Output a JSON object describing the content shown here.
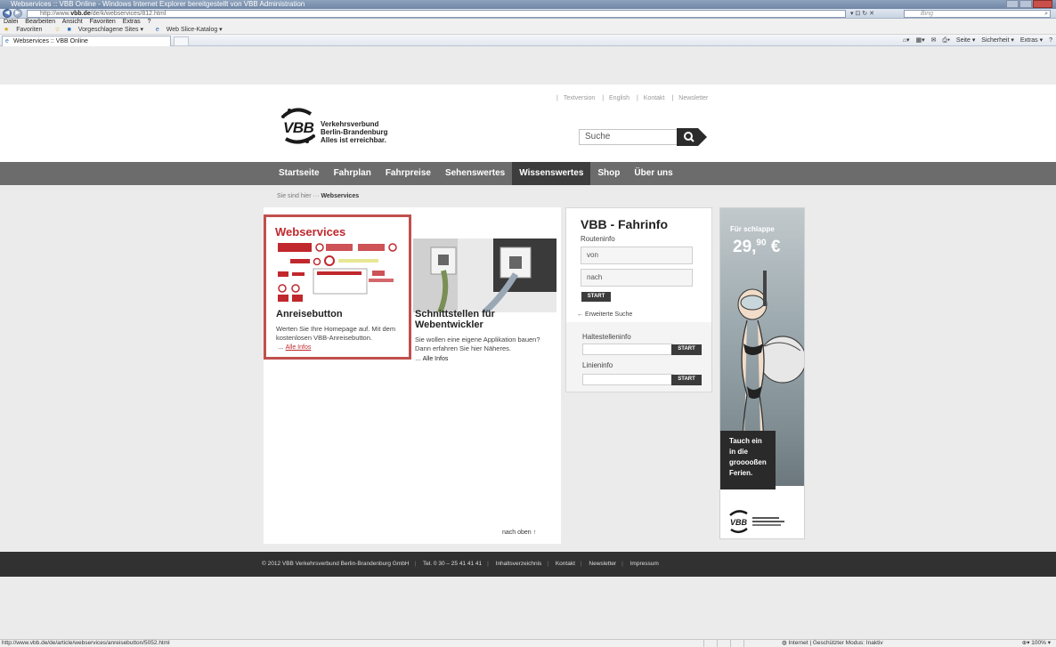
{
  "browser": {
    "window_title": "Webservices :: VBB Online - Windows Internet Explorer bereitgestellt von VBB Administration",
    "url_prefix": "http://www.",
    "url_domain": "vbb.de",
    "url_path": "/de/k/webservices/812.html",
    "search_placeholder": "Bing",
    "menu": [
      "Datei",
      "Bearbeiten",
      "Ansicht",
      "Favoriten",
      "Extras",
      "?"
    ],
    "favorites": {
      "label": "Favoriten",
      "suggested": "Vorgeschlagene Sites ▾",
      "slice": "Web Slice-Katalog ▾"
    },
    "tab_title": "Webservices :: VBB Online",
    "commands": [
      "Seite ▾",
      "Sicherheit ▾",
      "Extras ▾"
    ],
    "status_url": "http://www.vbb.de/de/article/webservices/anreisebutton/5052.html",
    "status_zone": "Internet | Geschützter Modus: Inaktiv",
    "status_zoom": "100%"
  },
  "header": {
    "logo_text": "VBB",
    "logo_line1": "Verkehrsverbund",
    "logo_line2": "Berlin-Brandenburg",
    "logo_line3": "Alles ist erreichbar.",
    "top_links": [
      "Textversion",
      "English",
      "Kontakt",
      "Newsletter"
    ],
    "search_value": "Suche"
  },
  "nav": {
    "items": [
      "Startseite",
      "Fahrplan",
      "Fahrpreise",
      "Sehenswertes",
      "Wissenswertes",
      "Shop",
      "Über uns"
    ],
    "active_index": 4
  },
  "breadcrumb": {
    "prefix": "Sie sind hier",
    "current": "Webservices"
  },
  "content": {
    "title": "Webservices",
    "teaser1": {
      "heading": "Anreisebutton",
      "text": "Werten Sie Ihre Homepage auf. Mit dem kostenlosen VBB-Anreisebutton.",
      "link": "Alle Infos"
    },
    "teaser2": {
      "heading": "Schnittstellen für Webentwickler",
      "text": "Sie wollen eine eigene Applikation bauen? Dann erfahren Sie hier Näheres.",
      "link": "Alle Infos"
    },
    "back_to_top": "nach oben ↑"
  },
  "fahrinfo": {
    "title": "VBB - Fahrinfo",
    "subtitle": "Routeninfo",
    "from_placeholder": "von",
    "to_placeholder": "nach",
    "start": "START",
    "advanced": "Erweiterte Suche",
    "stop_label": "Haltestelleninfo",
    "line_label": "Linieninfo"
  },
  "ad": {
    "top_text": "Für schlappe",
    "price_int": "29,",
    "price_dec": "90",
    "price_cur": " €",
    "line1": "Tauch ein",
    "line2": "in die",
    "line3": "grooooßen",
    "line4": "Ferien."
  },
  "footer": {
    "copyright": "© 2012 VBB Verkehrsverbund Berlin-Brandenburg GmbH",
    "phone": "Tel. 0 30 – 25 41 41 41",
    "links": [
      "Inhaltsverzeichnis",
      "Kontakt",
      "Newsletter",
      "Impressum"
    ]
  }
}
